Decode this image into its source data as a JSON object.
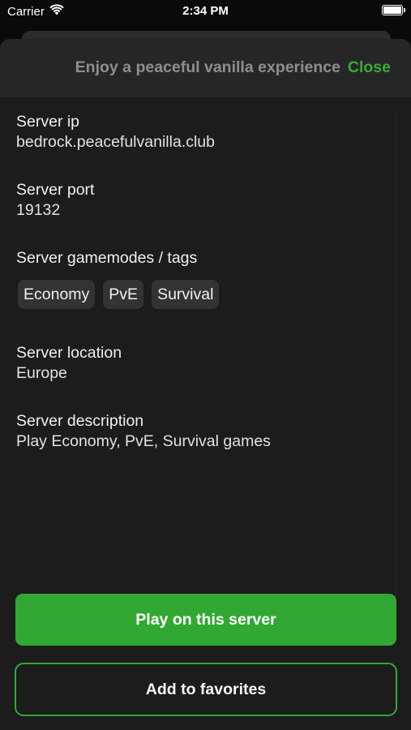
{
  "status_bar": {
    "carrier": "Carrier",
    "time": "2:34 PM",
    "battery_level": 1.0
  },
  "sheet": {
    "title": "Enjoy a peaceful vanilla experience",
    "close_label": "Close"
  },
  "fields": {
    "ip": {
      "label": "Server ip",
      "value": "bedrock.peacefulvanilla.club"
    },
    "port": {
      "label": "Server port",
      "value": "19132"
    },
    "gamemodes": {
      "label": "Server gamemodes / tags",
      "tags": [
        "Economy",
        "PvE",
        "Survival"
      ]
    },
    "location": {
      "label": "Server location",
      "value": "Europe"
    },
    "description": {
      "label": "Server description",
      "value": "Play Economy, PvE, Survival games"
    }
  },
  "buttons": {
    "play": "Play on this server",
    "favorites": "Add to favorites"
  },
  "colors": {
    "accent": "#32a834",
    "background": "#1c1c1c",
    "header": "#262626",
    "tag": "#333333"
  }
}
